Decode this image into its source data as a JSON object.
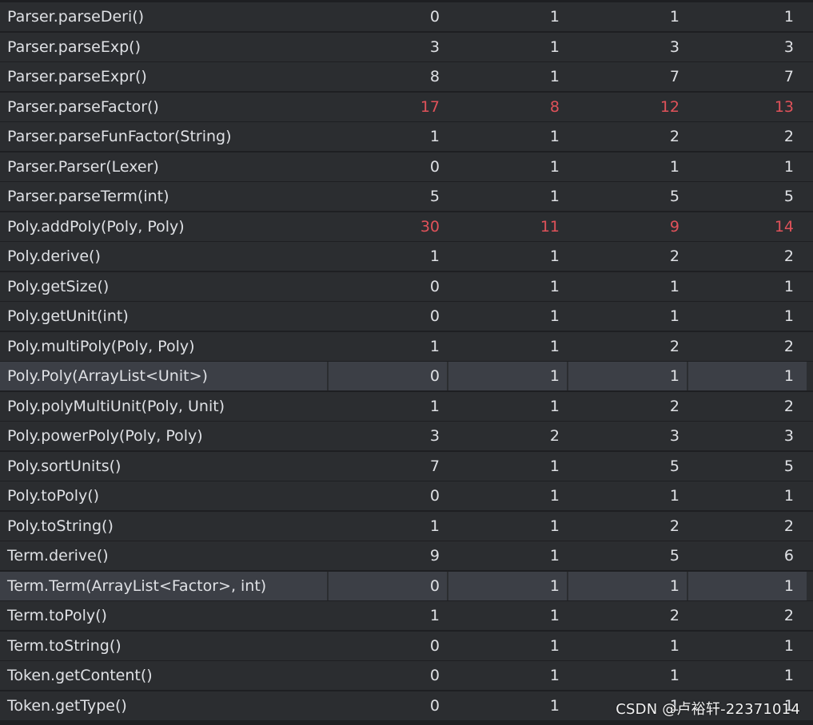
{
  "colors": {
    "background": "#2b2d30",
    "selected_row": "#3c3f46",
    "text": "#dfe1e5",
    "highlight": "#e0525a"
  },
  "rows": [
    {
      "method": "Parser.parseDeri()",
      "values": [
        "0",
        "1",
        "1",
        "1"
      ],
      "highlight": false,
      "selected": false
    },
    {
      "method": "Parser.parseExp()",
      "values": [
        "3",
        "1",
        "3",
        "3"
      ],
      "highlight": false,
      "selected": false
    },
    {
      "method": "Parser.parseExpr()",
      "values": [
        "8",
        "1",
        "7",
        "7"
      ],
      "highlight": false,
      "selected": false
    },
    {
      "method": "Parser.parseFactor()",
      "values": [
        "17",
        "8",
        "12",
        "13"
      ],
      "highlight": true,
      "selected": false
    },
    {
      "method": "Parser.parseFunFactor(String)",
      "values": [
        "1",
        "1",
        "2",
        "2"
      ],
      "highlight": false,
      "selected": false
    },
    {
      "method": "Parser.Parser(Lexer)",
      "values": [
        "0",
        "1",
        "1",
        "1"
      ],
      "highlight": false,
      "selected": false
    },
    {
      "method": "Parser.parseTerm(int)",
      "values": [
        "5",
        "1",
        "5",
        "5"
      ],
      "highlight": false,
      "selected": false
    },
    {
      "method": "Poly.addPoly(Poly, Poly)",
      "values": [
        "30",
        "11",
        "9",
        "14"
      ],
      "highlight": true,
      "selected": false
    },
    {
      "method": "Poly.derive()",
      "values": [
        "1",
        "1",
        "2",
        "2"
      ],
      "highlight": false,
      "selected": false
    },
    {
      "method": "Poly.getSize()",
      "values": [
        "0",
        "1",
        "1",
        "1"
      ],
      "highlight": false,
      "selected": false
    },
    {
      "method": "Poly.getUnit(int)",
      "values": [
        "0",
        "1",
        "1",
        "1"
      ],
      "highlight": false,
      "selected": false
    },
    {
      "method": "Poly.multiPoly(Poly, Poly)",
      "values": [
        "1",
        "1",
        "2",
        "2"
      ],
      "highlight": false,
      "selected": false
    },
    {
      "method": "Poly.Poly(ArrayList<Unit>)",
      "values": [
        "0",
        "1",
        "1",
        "1"
      ],
      "highlight": false,
      "selected": true
    },
    {
      "method": "Poly.polyMultiUnit(Poly, Unit)",
      "values": [
        "1",
        "1",
        "2",
        "2"
      ],
      "highlight": false,
      "selected": false
    },
    {
      "method": "Poly.powerPoly(Poly, Poly)",
      "values": [
        "3",
        "2",
        "3",
        "3"
      ],
      "highlight": false,
      "selected": false
    },
    {
      "method": "Poly.sortUnits()",
      "values": [
        "7",
        "1",
        "5",
        "5"
      ],
      "highlight": false,
      "selected": false
    },
    {
      "method": "Poly.toPoly()",
      "values": [
        "0",
        "1",
        "1",
        "1"
      ],
      "highlight": false,
      "selected": false
    },
    {
      "method": "Poly.toString()",
      "values": [
        "1",
        "1",
        "2",
        "2"
      ],
      "highlight": false,
      "selected": false
    },
    {
      "method": "Term.derive()",
      "values": [
        "9",
        "1",
        "5",
        "6"
      ],
      "highlight": false,
      "selected": false
    },
    {
      "method": "Term.Term(ArrayList<Factor>, int)",
      "values": [
        "0",
        "1",
        "1",
        "1"
      ],
      "highlight": false,
      "selected": true
    },
    {
      "method": "Term.toPoly()",
      "values": [
        "1",
        "1",
        "2",
        "2"
      ],
      "highlight": false,
      "selected": false
    },
    {
      "method": "Term.toString()",
      "values": [
        "0",
        "1",
        "1",
        "1"
      ],
      "highlight": false,
      "selected": false
    },
    {
      "method": "Token.getContent()",
      "values": [
        "0",
        "1",
        "1",
        "1"
      ],
      "highlight": false,
      "selected": false
    },
    {
      "method": "Token.getType()",
      "values": [
        "0",
        "1",
        "1",
        "1"
      ],
      "highlight": false,
      "selected": false
    }
  ],
  "watermark": "CSDN @卢裕轩-22371014"
}
